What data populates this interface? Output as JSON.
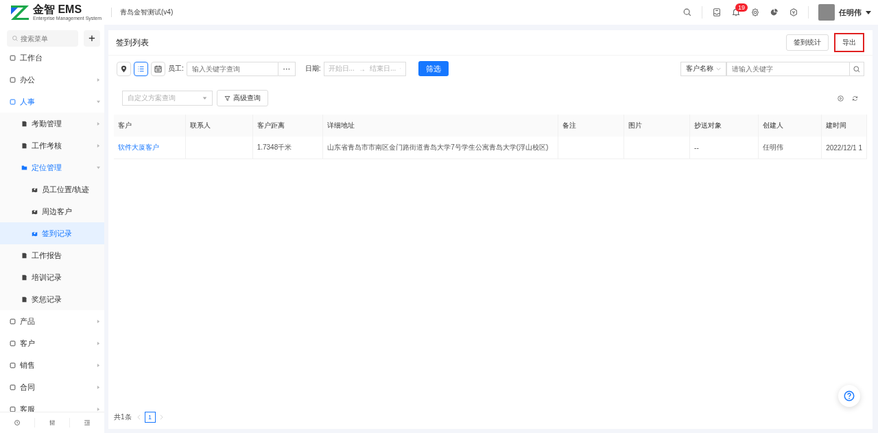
{
  "header": {
    "logo": "金智 EMS",
    "logo_subtitle": "Enterprise Management System",
    "company": "青岛金智测试(v4)",
    "notification_count": "19",
    "user": "任明伟"
  },
  "sidebar": {
    "search": {
      "placeholder": "搜索菜单"
    },
    "add_button": "+",
    "items": [
      {
        "label": "工作台",
        "selected": false
      },
      {
        "label": "办公",
        "selected": false,
        "expanded": false
      },
      {
        "label": "人事",
        "selected": false,
        "expanded": true,
        "children": [
          {
            "label": "考勤管理",
            "selected": false,
            "expanded": false
          },
          {
            "label": "工作考核",
            "selected": false,
            "expanded": false
          },
          {
            "label": "定位管理",
            "selected": false,
            "expanded": true,
            "children": [
              {
                "label": "员工位置/轨迹",
                "selected": false
              },
              {
                "label": "周边客户",
                "selected": false
              },
              {
                "label": "签到记录",
                "selected": true
              }
            ]
          },
          {
            "label": "工作报告",
            "selected": false
          },
          {
            "label": "培训记录",
            "selected": false
          },
          {
            "label": "奖惩记录",
            "selected": false
          }
        ]
      },
      {
        "label": "产品",
        "selected": false,
        "expanded": false
      },
      {
        "label": "客户",
        "selected": false,
        "expanded": false
      },
      {
        "label": "销售",
        "selected": false,
        "expanded": false
      },
      {
        "label": "合同",
        "selected": false,
        "expanded": false
      },
      {
        "label": "客服",
        "selected": false,
        "expanded": false
      }
    ]
  },
  "page": {
    "title": "签到列表",
    "actions": [
      {
        "label": "签到统计",
        "highlighted": false
      },
      {
        "label": "导出",
        "highlighted": true
      }
    ]
  },
  "toolbar": {
    "views": [
      {
        "kind": "map",
        "selected": false
      },
      {
        "kind": "list",
        "selected": true
      },
      {
        "kind": "calendar",
        "selected": false
      }
    ],
    "employee_label": "员工:",
    "employee_placeholder": "输入关键字查询",
    "more_button": "···",
    "date_label": "日期:",
    "date_start_placeholder": "开始日...",
    "date_arrow": "→",
    "date_end_placeholder": "结束日...",
    "filter_button": "筛选",
    "search_field_select": "客户名称",
    "search_placeholder": "请输入关键字"
  },
  "query_bar": {
    "scheme_placeholder": "自定义方案查询",
    "advanced_button": "高级查询"
  },
  "table": {
    "columns": [
      "客户",
      "联系人",
      "客户距离",
      "详细地址",
      "备注",
      "图片",
      "抄送对象",
      "创建人",
      "建时间"
    ],
    "rows": [
      [
        "软件大厦客户",
        "",
        "1.7348千米",
        "山东省青岛市市南区金门路街道青岛大学7号学生公寓青岛大学(浮山校区)",
        "",
        "",
        "--",
        "任明伟",
        "2022/12/1 1"
      ]
    ]
  },
  "pagination": {
    "total": "共1条",
    "pages": [
      {
        "label": "1",
        "selected": true
      }
    ]
  }
}
